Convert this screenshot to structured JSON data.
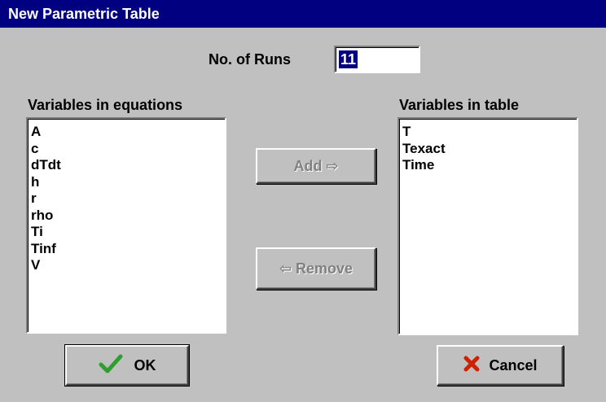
{
  "window": {
    "title": "New Parametric Table"
  },
  "runs": {
    "label": "No. of Runs",
    "value": "11"
  },
  "left_list": {
    "heading": "Variables in equations",
    "items": [
      "A",
      "c",
      "dTdt",
      "h",
      "r",
      "rho",
      "Ti",
      "Tinf",
      "V"
    ]
  },
  "right_list": {
    "heading": "Variables in table",
    "items": [
      "T",
      "Texact",
      "Time"
    ]
  },
  "buttons": {
    "add": "Add ⇨",
    "remove": "⇦ Remove",
    "ok": "OK",
    "cancel": "Cancel"
  },
  "icons": {
    "ok": "checkmark-icon",
    "cancel": "x-icon"
  },
  "colors": {
    "titlebar": "#000080",
    "ok_check": "#2e9e2e",
    "cancel_x": "#cc2200",
    "face": "#c0c0c0"
  }
}
